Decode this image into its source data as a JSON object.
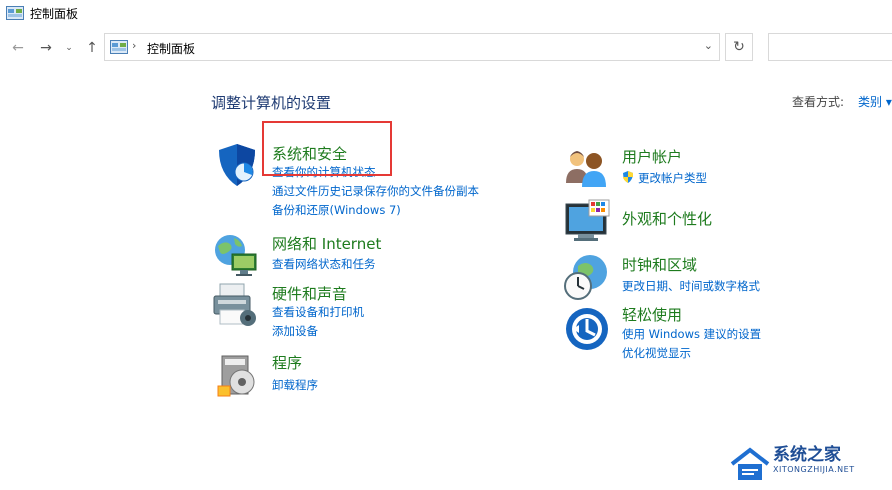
{
  "window": {
    "title": "控制面板"
  },
  "address": {
    "path": "控制面板"
  },
  "heading": "调整计算机的设置",
  "view_by": {
    "label": "查看方式:",
    "value": "类别 ▾"
  },
  "left": [
    {
      "title": "系统和安全",
      "links": [
        "查看你的计算机状态",
        "通过文件历史记录保存你的文件备份副本",
        "备份和还原(Windows 7)"
      ]
    },
    {
      "title": "网络和 Internet",
      "links": [
        "查看网络状态和任务"
      ]
    },
    {
      "title": "硬件和声音",
      "links": [
        "查看设备和打印机",
        "添加设备"
      ]
    },
    {
      "title": "程序",
      "links": [
        "卸载程序"
      ]
    }
  ],
  "right": [
    {
      "title": "用户帐户",
      "links": [
        "更改帐户类型"
      ]
    },
    {
      "title": "外观和个性化",
      "links": []
    },
    {
      "title": "时钟和区域",
      "links": [
        "更改日期、时间或数字格式"
      ]
    },
    {
      "title": "轻松使用",
      "links": [
        "使用 Windows 建议的设置",
        "优化视觉显示"
      ]
    }
  ],
  "watermark": {
    "title": "系统之家",
    "subtitle": "XITONGZHIJIA.NET"
  },
  "icons": {
    "nav_back": "←",
    "nav_forward": "→",
    "nav_history": "⌄",
    "nav_up": "↑",
    "breadcrumb_separator": "›",
    "address_dropdown": "⌄",
    "refresh": "↻"
  },
  "colors": {
    "category_title": "#1e7b1e",
    "link": "#0066cc",
    "heading": "#1f3b73",
    "highlight": "#e53935"
  }
}
